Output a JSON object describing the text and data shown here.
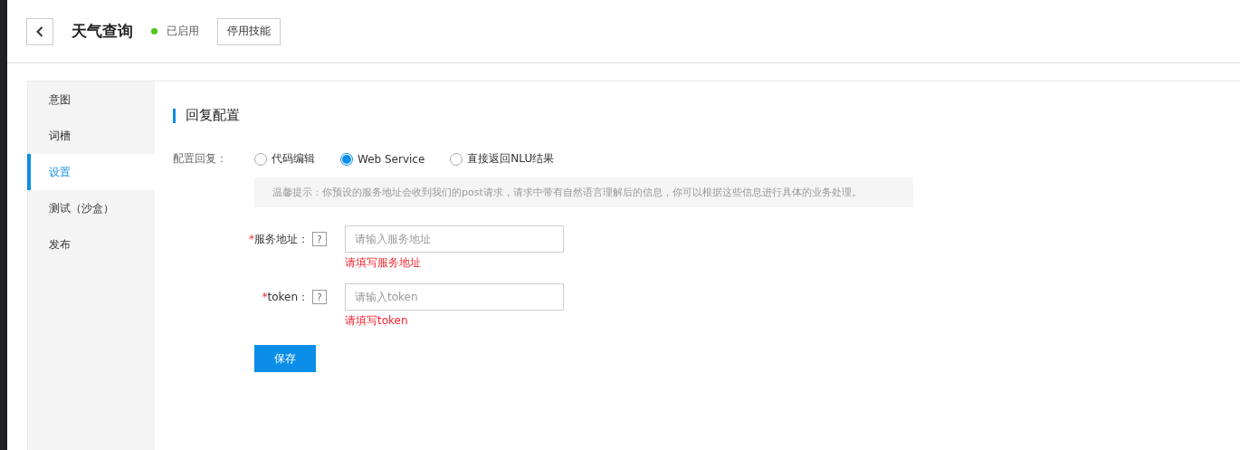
{
  "header": {
    "title": "天气查询",
    "status": {
      "label": "已启用",
      "color": "#52c41a"
    },
    "action": "停用技能"
  },
  "sidebar": {
    "items": [
      {
        "label": "意图",
        "selected": false
      },
      {
        "label": "词槽",
        "selected": false
      },
      {
        "label": "设置",
        "selected": true
      },
      {
        "label": "测试（沙盒）",
        "selected": false
      },
      {
        "label": "发布",
        "selected": false
      }
    ]
  },
  "section": {
    "title": "回复配置",
    "reply": {
      "label": "配置回复：",
      "options": [
        {
          "label": "代码编辑",
          "selected": false
        },
        {
          "label": "Web Service",
          "selected": true
        },
        {
          "label": "直接返回NLU结果",
          "selected": false
        }
      ]
    },
    "tip": "温馨提示：你预设的服务地址会收到我们的post请求，请求中带有自然语言理解后的信息，你可以根据这些信息进行具体的业务处理。",
    "fields": [
      {
        "required": "*",
        "label": "服务地址：",
        "help": "?",
        "placeholder": "请输入服务地址",
        "error": "请填写服务地址"
      },
      {
        "required": "*",
        "label": "token：",
        "help": "?",
        "placeholder": "请输入token",
        "error": "请填写token"
      }
    ],
    "save": "保存"
  }
}
